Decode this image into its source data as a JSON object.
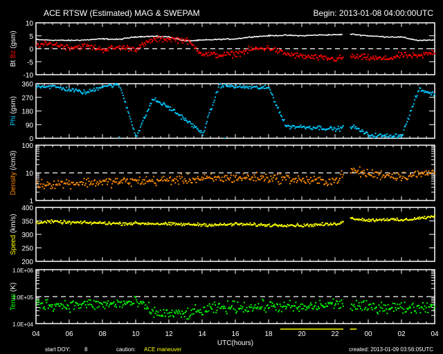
{
  "title": "ACE RTSW (Estimated) MAG & SWEPAM",
  "begin": "Begin: 2013-01-08 04:00:00UTC",
  "footer": {
    "start_doy_label": "start DOY:",
    "start_doy": "8",
    "caution_label": "caution:",
    "caution_value": "ACE maneuver",
    "created": "created: 2013-01-09 03:56:05UTC"
  },
  "colors": {
    "bt": "#ffffff",
    "bz": "#ff0000",
    "phi": "#00c8ff",
    "density": "#ff8c00",
    "speed": "#ffff00",
    "temp": "#00ff00",
    "caution": "#ffff00"
  },
  "chart_data": {
    "type": "scatter",
    "xlabel": "UTC(hours)",
    "x_tick_labels": [
      "04",
      "06",
      "08",
      "10",
      "12",
      "14",
      "16",
      "18",
      "20",
      "22",
      "00",
      "02",
      "04"
    ],
    "x_range_hours": [
      0,
      24
    ],
    "data_gap_hours": [
      18.5,
      18.9
    ],
    "caution_intervals_hours": [
      [
        14.7,
        18.5
      ],
      [
        18.9,
        19.3
      ]
    ],
    "panels": [
      {
        "id": "mag",
        "ylabel_parts": [
          {
            "text": "Bt",
            "color": "#ffffff"
          },
          {
            "text": " Bz",
            "color": "#ff0000"
          },
          {
            "text": " (gsm)",
            "color": "#ffffff"
          }
        ],
        "scale": "linear",
        "ylim": [
          -10,
          10
        ],
        "tick_labels": [
          "10",
          "5",
          "0",
          "-5",
          "-10"
        ],
        "tick_values": [
          10,
          5,
          0,
          -5,
          -10
        ],
        "dashed_at": 0,
        "series": [
          {
            "name": "Bt",
            "color": "#ffffff",
            "mode": "line",
            "hourly": [
              3.5,
              3.3,
              3.2,
              3.4,
              3.8,
              3.6,
              4.6,
              4.8,
              4.6,
              3.0,
              3.3,
              3.6,
              3.8,
              4.6,
              5.0,
              5.2,
              5.0,
              5.3,
              5.4,
              5.6,
              5.0,
              4.6,
              4.5,
              3.2,
              3.3
            ]
          },
          {
            "name": "Bz",
            "color": "#ff0000",
            "mode": "dots",
            "scatter": 0.8,
            "hourly": [
              1.5,
              1.8,
              0.5,
              1.0,
              -0.3,
              0.5,
              0.0,
              3.5,
              3.8,
              3.3,
              -2.0,
              -2.5,
              -2.0,
              -0.2,
              0.3,
              -2.0,
              -3.0,
              -3.5,
              -4.0,
              -3.0,
              -3.5,
              -4.0,
              -2.5,
              -3.0,
              -1.0
            ]
          }
        ]
      },
      {
        "id": "phi",
        "ylabel_parts": [
          {
            "text": "Phi",
            "color": "#00c8ff"
          },
          {
            "text": " (gsm)",
            "color": "#ffffff"
          }
        ],
        "scale": "linear",
        "ylim": [
          0,
          360
        ],
        "tick_labels": [
          "360",
          "270",
          "180",
          "90",
          "0"
        ],
        "tick_values": [
          360,
          270,
          180,
          90,
          0
        ],
        "series": [
          {
            "name": "Phi",
            "color": "#00c8ff",
            "mode": "dots",
            "scatter": 10,
            "hourly": [
              345,
              340,
              320,
              300,
              345,
              350,
              10,
              260,
              200,
              120,
              30,
              350,
              340,
              335,
              330,
              80,
              75,
              70,
              60,
              80,
              20,
              15,
              20,
              320,
              290
            ]
          }
        ]
      },
      {
        "id": "density",
        "ylabel_parts": [
          {
            "text": "Density",
            "color": "#ff8c00"
          },
          {
            "text": " (/cm3)",
            "color": "#ffffff"
          }
        ],
        "scale": "log",
        "ylim": [
          1,
          100
        ],
        "tick_labels": [
          "100",
          "10",
          "1"
        ],
        "tick_values": [
          100,
          10,
          1
        ],
        "dashed_at": 10,
        "series": [
          {
            "name": "Density",
            "color": "#ff8c00",
            "mode": "dots",
            "scatter": 0.12,
            "hourly": [
              3.8,
              4.0,
              4.3,
              4.5,
              4.6,
              4.8,
              5.0,
              5.2,
              5.5,
              5.8,
              6.0,
              6.2,
              6.5,
              6.8,
              6.5,
              6.2,
              5.5,
              5.0,
              5.2,
              12,
              9,
              8.5,
              7.5,
              8.5,
              11
            ]
          }
        ]
      },
      {
        "id": "speed",
        "ylabel_parts": [
          {
            "text": "Speed",
            "color": "#ffff00"
          },
          {
            "text": " (km/s)",
            "color": "#ffffff"
          }
        ],
        "scale": "linear",
        "ylim": [
          200,
          400
        ],
        "tick_labels": [
          "400",
          "350",
          "300",
          "250",
          "200"
        ],
        "tick_values": [
          400,
          350,
          300,
          250,
          200
        ],
        "series": [
          {
            "name": "Speed",
            "color": "#ffff00",
            "mode": "dots",
            "scatter": 4,
            "hourly": [
              345,
              347,
              344,
              343,
              342,
              340,
              341,
              340,
              338,
              337,
              336,
              335,
              338,
              336,
              334,
              335,
              333,
              336,
              338,
              360,
              352,
              356,
              352,
              360,
              366
            ]
          }
        ]
      },
      {
        "id": "temp",
        "ylabel_parts": [
          {
            "text": "Temp",
            "color": "#00ff00"
          },
          {
            "text": " (K)",
            "color": "#ffffff"
          }
        ],
        "scale": "log",
        "ylim": [
          10000,
          1000000
        ],
        "tick_labels": [
          "1.0E+06",
          "1.0E+05",
          "1.0E+04"
        ],
        "tick_values": [
          1000000,
          100000,
          10000
        ],
        "dashed_at": 100000,
        "series": [
          {
            "name": "Temp",
            "color": "#00ff00",
            "mode": "dots",
            "scatter": 0.15,
            "hourly": [
              55000,
              50000,
              48000,
              52000,
              50000,
              55000,
              60000,
              25000,
              23000,
              22000,
              30000,
              38000,
              42000,
              40000,
              45000,
              42000,
              38000,
              45000,
              55000,
              45000,
              40000,
              42000,
              38000,
              40000,
              45000
            ]
          }
        ]
      }
    ]
  }
}
